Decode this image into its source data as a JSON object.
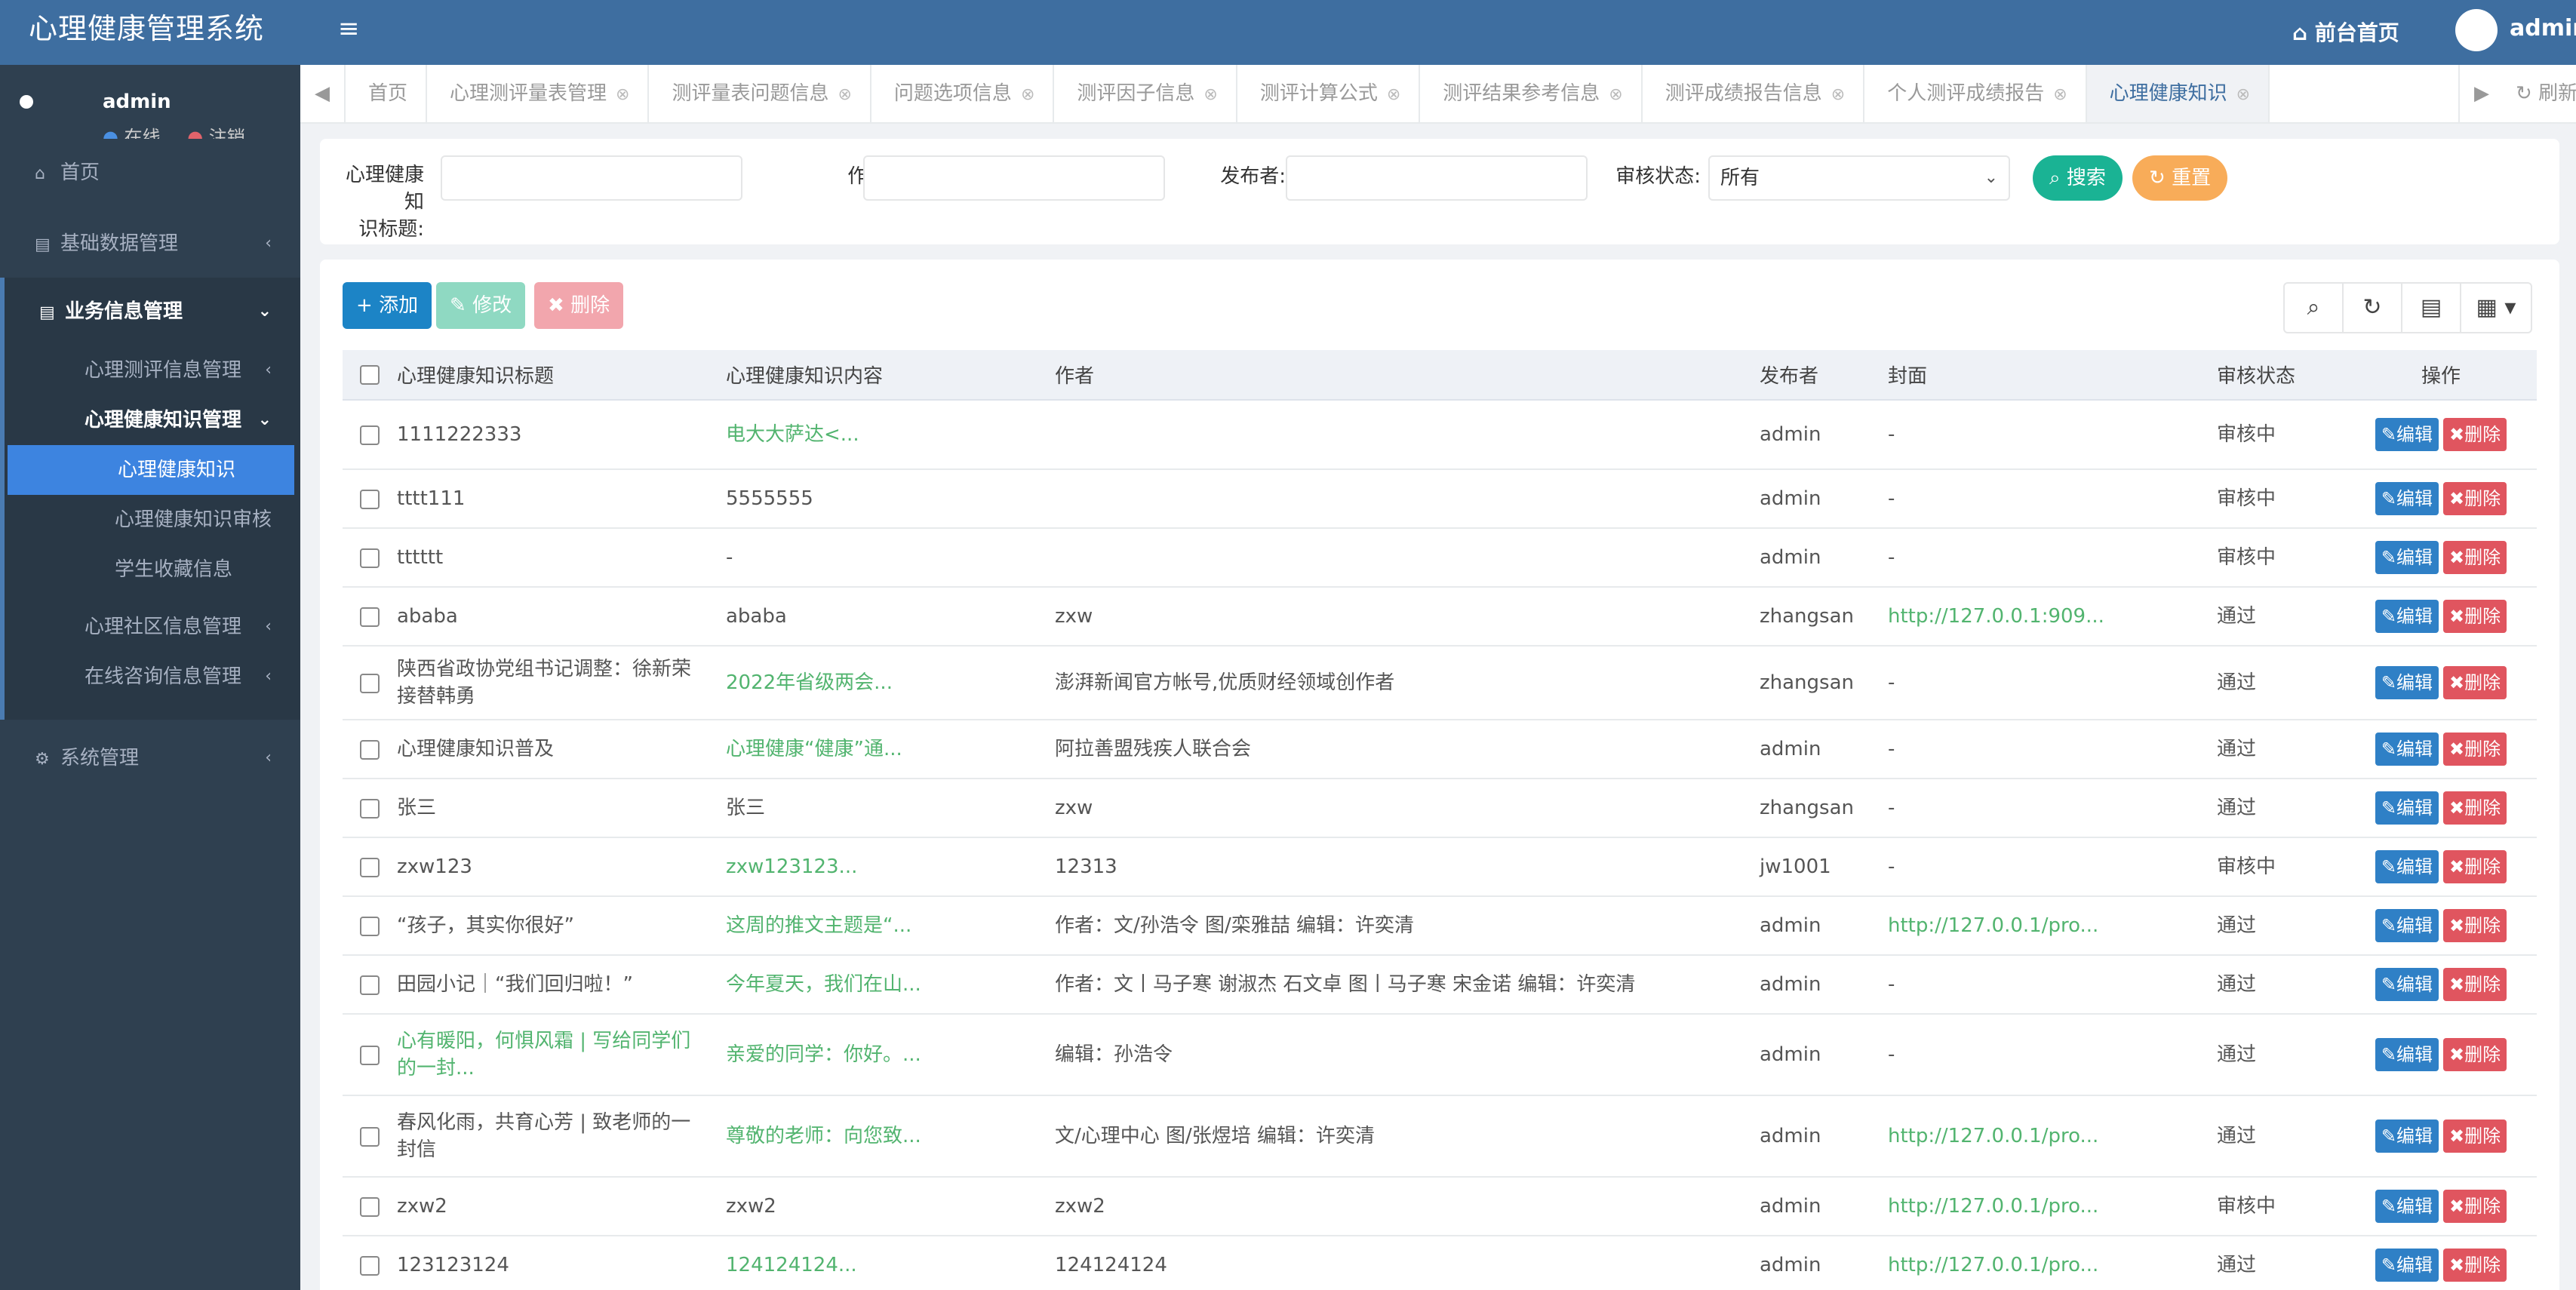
{
  "app": {
    "title": "心理健康管理系统"
  },
  "header": {
    "home_link": "前台首页",
    "user": "admin"
  },
  "sidebar": {
    "user_name": "admin",
    "status_online": "在线",
    "status_logout": "注销",
    "home": "首页",
    "basic": "基础数据管理",
    "biz": "业务信息管理",
    "eval": "心理测评信息管理",
    "knowledge": "心理健康知识管理",
    "knowledge_items": [
      "心理健康知识",
      "心理健康知识审核",
      "学生收藏信息"
    ],
    "community": "心理社区信息管理",
    "consult": "在线咨询信息管理",
    "system": "系统管理"
  },
  "tabs": [
    {
      "label": "首页",
      "closable": false
    },
    {
      "label": "心理测评量表管理",
      "closable": true
    },
    {
      "label": "测评量表问题信息",
      "closable": true
    },
    {
      "label": "问题选项信息",
      "closable": true
    },
    {
      "label": "测评因子信息",
      "closable": true
    },
    {
      "label": "测评计算公式",
      "closable": true
    },
    {
      "label": "测评结果参考信息",
      "closable": true
    },
    {
      "label": "测评成绩报告信息",
      "closable": true
    },
    {
      "label": "个人测评成绩报告",
      "closable": true
    },
    {
      "label": "心理健康知识",
      "closable": true,
      "active": true
    }
  ],
  "refresh": "刷新",
  "search": {
    "title_label_1": "心理健康知",
    "title_label_2": "识标题:",
    "author_label": "作者:",
    "publisher_label": "发布者:",
    "status_label": "审核状态:",
    "status_value": "所有",
    "search_btn": "搜索",
    "reset_btn": "重置"
  },
  "toolbar": {
    "add": "添加",
    "edit": "修改",
    "delete": "删除"
  },
  "table": {
    "headers": [
      "心理健康知识标题",
      "心理健康知识内容",
      "作者",
      "发布者",
      "封面",
      "审核状态",
      "操作"
    ],
    "edit_label": "编辑",
    "delete_label": "删除",
    "rows": [
      {
        "title": "1111222333",
        "content": "电大大萨达<...",
        "author": "",
        "publisher": "admin",
        "cover": "-",
        "status": "审核中"
      },
      {
        "title": "tttt111",
        "content": "5555555",
        "author": "",
        "publisher": "admin",
        "cover": "-",
        "status": "审核中"
      },
      {
        "title": "tttttt",
        "content": "-",
        "author": "",
        "publisher": "admin",
        "cover": "-",
        "status": "审核中"
      },
      {
        "title": "ababa",
        "content": "ababa",
        "author": "zxw",
        "publisher": "zhangsan",
        "cover": "http://127.0.0.1:909...",
        "status": "通过"
      },
      {
        "title": "陕西省政协党组书记调整：徐新荣接替韩勇",
        "content": "2022年省级两会...",
        "author": "澎湃新闻官方帐号,优质财经领域创作者",
        "publisher": "zhangsan",
        "cover": "-",
        "status": "通过"
      },
      {
        "title": "心理健康知识普及",
        "content": "心理健康“健康”通...",
        "author": "阿拉善盟残疾人联合会",
        "publisher": "admin",
        "cover": "-",
        "status": "通过"
      },
      {
        "title": "张三",
        "content": "张三",
        "author": "zxw",
        "publisher": "zhangsan",
        "cover": "-",
        "status": "通过"
      },
      {
        "title": "zxw123",
        "content": "zxw123123...",
        "author": "12313",
        "publisher": "jw1001",
        "cover": "-",
        "status": "审核中"
      },
      {
        "title": "“孩子，其实你很好”",
        "content": "这周的推文主题是“...",
        "author": "作者：文/孙浩令 图/栾雅喆 编辑：许奕清",
        "publisher": "admin",
        "cover": "http://127.0.0.1/pro...",
        "status": "通过"
      },
      {
        "title": "田园小记｜“我们回归啦！”",
        "content": "今年夏天，我们在山...",
        "author": "作者：文丨马子寒 谢淑杰 石文卓 图丨马子寒 宋金诺 编辑：许奕清",
        "publisher": "admin",
        "cover": "-",
        "status": "通过"
      },
      {
        "title": "心有暖阳，何惧风霜 | 写给同学们的一封...",
        "content": "亲爱的同学：你好。...",
        "author": "编辑：孙浩令",
        "publisher": "admin",
        "cover": "-",
        "status": "通过",
        "title_green": true
      },
      {
        "title": "春风化雨，共育心芳 | 致老师的一封信",
        "content": "尊敬的老师：向您致...",
        "author": "文/心理中心 图/张煜培 编辑：许奕清",
        "publisher": "admin",
        "cover": "http://127.0.0.1/pro...",
        "status": "通过"
      },
      {
        "title": "zxw2",
        "content": "zxw2",
        "author": "zxw2",
        "publisher": "admin",
        "cover": "http://127.0.0.1/pro...",
        "status": "审核中"
      },
      {
        "title": "123123124",
        "content": "124124124...",
        "author": "124124124",
        "publisher": "admin",
        "cover": "http://127.0.0.1/pro...",
        "status": "通过"
      }
    ]
  },
  "colors": {
    "header_blue": "#3e6ea0",
    "sidebar_dark": "#2f4050",
    "link_green": "#52b46f",
    "primary": "#1c84c6",
    "danger": "#e0555f"
  }
}
